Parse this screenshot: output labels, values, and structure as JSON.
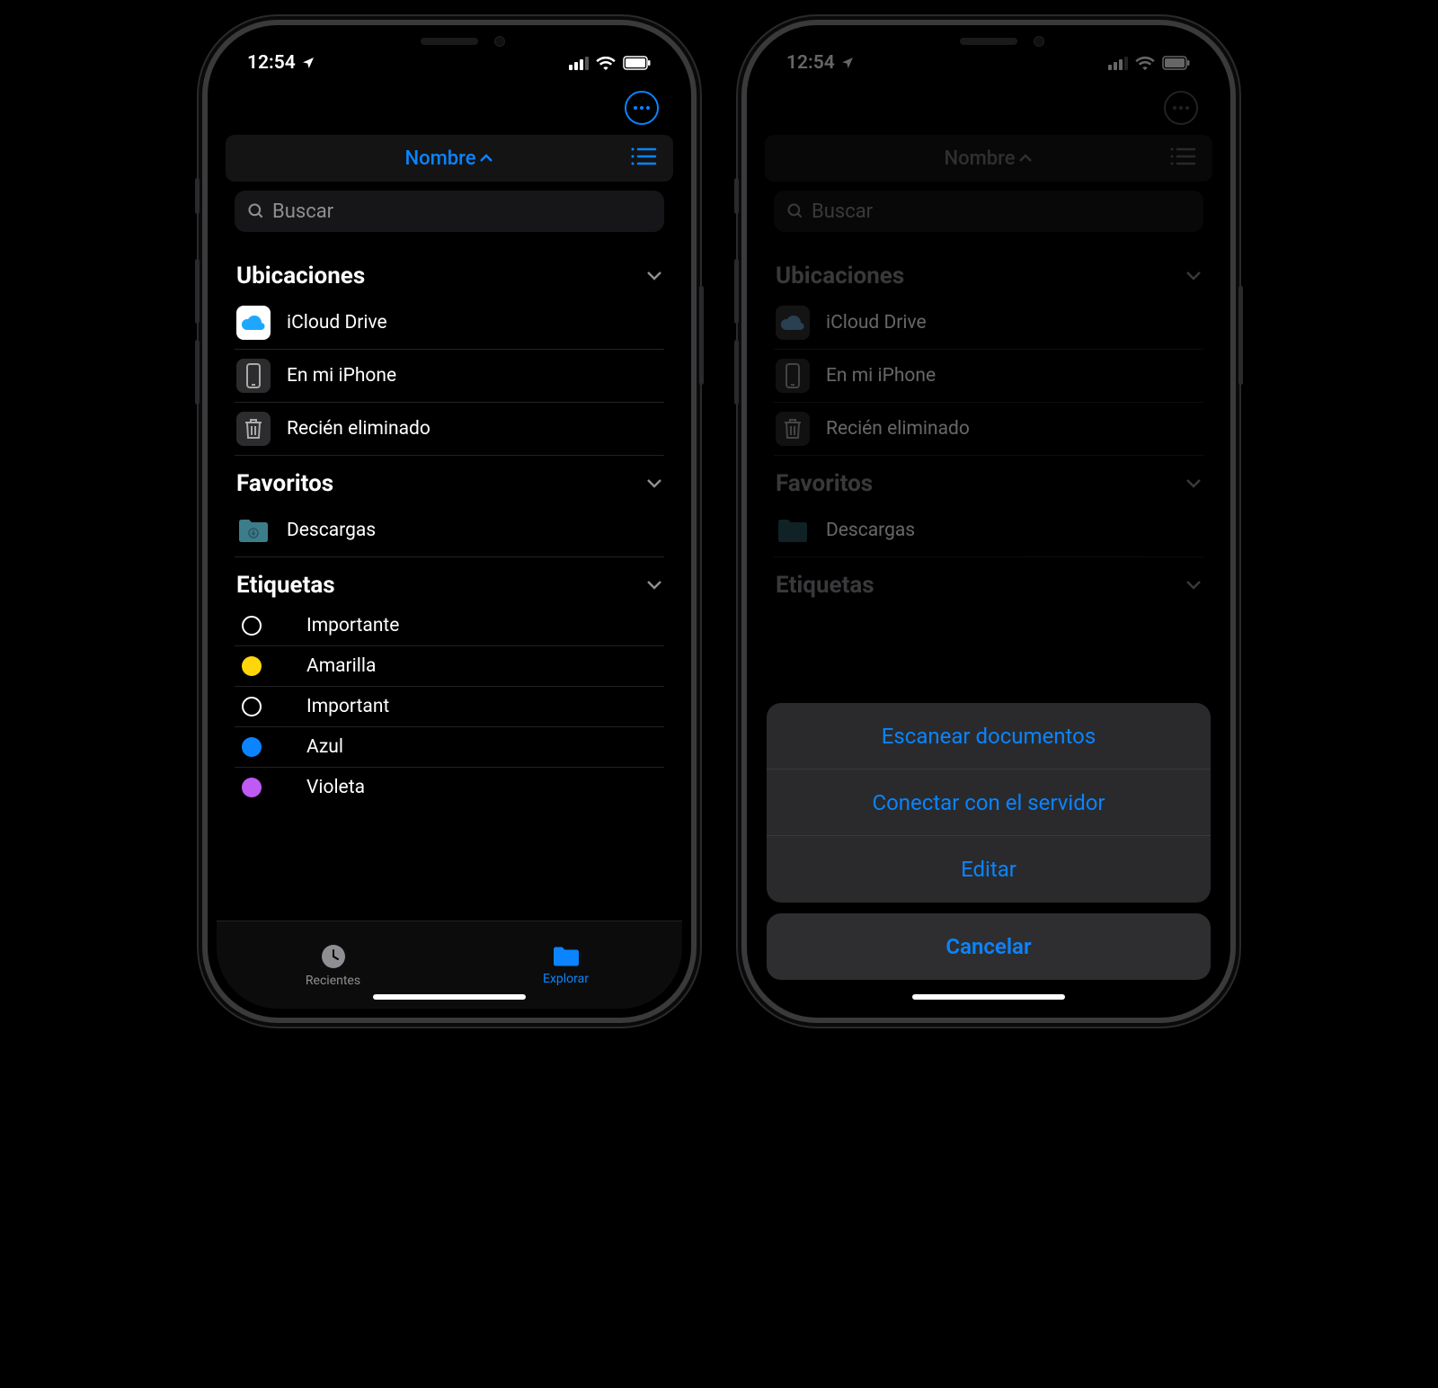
{
  "status": {
    "time": "12:54"
  },
  "topbar": {
    "sort_label": "Nombre"
  },
  "search": {
    "placeholder": "Buscar"
  },
  "sections": {
    "locations": {
      "title": "Ubicaciones",
      "items": [
        {
          "label": "iCloud Drive"
        },
        {
          "label": "En mi iPhone"
        },
        {
          "label": "Recién eliminado"
        }
      ]
    },
    "favorites": {
      "title": "Favoritos",
      "items": [
        {
          "label": "Descargas"
        }
      ]
    },
    "tags": {
      "title": "Etiquetas",
      "items": [
        {
          "label": "Importante",
          "color": "transparent"
        },
        {
          "label": "Amarilla",
          "color": "#ffd60a"
        },
        {
          "label": "Important",
          "color": "transparent"
        },
        {
          "label": "Azul",
          "color": "#0a84ff"
        },
        {
          "label": "Violeta",
          "color": "#bf5af2"
        }
      ]
    }
  },
  "tabs": {
    "recents": "Recientes",
    "browse": "Explorar"
  },
  "sheet": {
    "scan": "Escanear documentos",
    "connect": "Conectar con el servidor",
    "edit": "Editar",
    "cancel": "Cancelar"
  }
}
